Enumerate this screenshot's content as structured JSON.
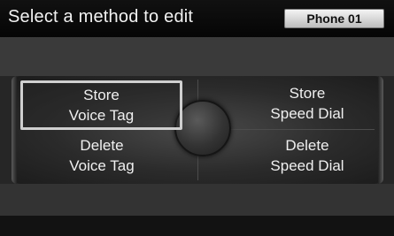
{
  "header": {
    "title": "Select a method to edit",
    "phone_label": "Phone 01"
  },
  "options": {
    "store_voice_tag": {
      "line1": "Store",
      "line2": "Voice Tag"
    },
    "store_speed_dial": {
      "line1": "Store",
      "line2": "Speed Dial"
    },
    "delete_voice_tag": {
      "line1": "Delete",
      "line2": "Voice Tag"
    },
    "delete_speed_dial": {
      "line1": "Delete",
      "line2": "Speed Dial"
    }
  },
  "selected_option": "store_voice_tag",
  "colors": {
    "background": "#262626",
    "header": "#0a0a0a",
    "text": "#f0f0f0",
    "highlight_border": "#cfcfcf"
  }
}
